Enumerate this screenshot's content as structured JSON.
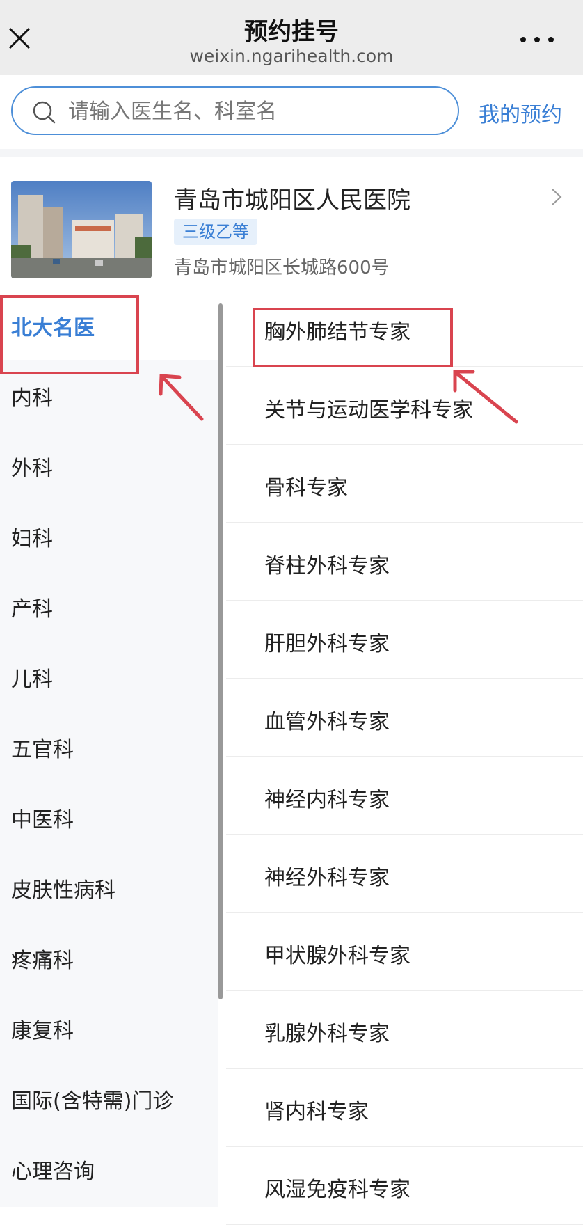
{
  "header": {
    "title": "预约挂号",
    "url": "weixin.ngarihealth.com"
  },
  "search": {
    "placeholder": "请输入医生名、科室名",
    "my_appointments": "我的预约"
  },
  "hospital": {
    "name": "青岛市城阳区人民医院",
    "level": "三级乙等",
    "address": "青岛市城阳区长城路600号"
  },
  "categories": [
    {
      "label": "北大名医",
      "active": true
    },
    {
      "label": "内科"
    },
    {
      "label": "外科"
    },
    {
      "label": "妇科"
    },
    {
      "label": "产科"
    },
    {
      "label": "儿科"
    },
    {
      "label": "五官科"
    },
    {
      "label": "中医科"
    },
    {
      "label": "皮肤性病科"
    },
    {
      "label": "疼痛科"
    },
    {
      "label": "康复科"
    },
    {
      "label": "国际(含特需)门诊"
    },
    {
      "label": "心理咨询"
    }
  ],
  "departments": [
    {
      "label": "胸外肺结节专家"
    },
    {
      "label": "关节与运动医学科专家"
    },
    {
      "label": "骨科专家"
    },
    {
      "label": "脊柱外科专家"
    },
    {
      "label": "肝胆外科专家"
    },
    {
      "label": "血管外科专家"
    },
    {
      "label": "神经内科专家"
    },
    {
      "label": "神经外科专家"
    },
    {
      "label": "甲状腺外科专家"
    },
    {
      "label": "乳腺外科专家"
    },
    {
      "label": "肾内科专家"
    },
    {
      "label": "风湿免疫科专家"
    }
  ],
  "colors": {
    "accent": "#3a7fd5",
    "annotation": "#d9444f"
  }
}
